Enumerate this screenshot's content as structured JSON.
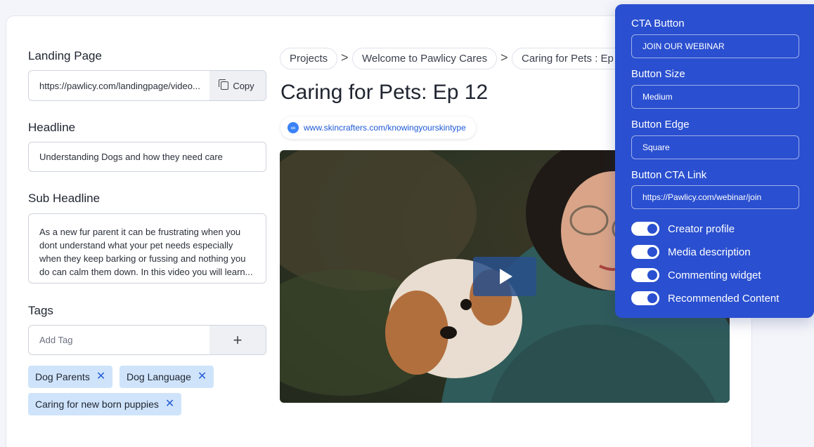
{
  "left": {
    "landing_label": "Landing Page",
    "landing_url": "https://pawlicy.com/landingpage/video...",
    "copy_label": "Copy",
    "headline_label": "Headline",
    "headline_value": "Understanding Dogs and how they need care",
    "sub_label": "Sub Headline",
    "sub_value": "As a new fur parent it can be frustrating when you dont understand what your pet needs especially when they keep barking or fussing and nothing you do can calm them down. In this video you will learn...",
    "tags_label": "Tags",
    "tag_placeholder": "Add Tag",
    "add_glyph": "+",
    "tags": [
      "Dog Parents",
      "Dog Language",
      "Caring for new born puppies"
    ],
    "remove_glyph": "✕"
  },
  "breadcrumb": [
    "Projects",
    "Welcome to Pawlicy Cares",
    "Caring for Pets : Ep"
  ],
  "breadcrumb_sep": ">",
  "title": "Caring for Pets: Ep 12",
  "link": "www.skincrafters.com/knowingyourskintype",
  "panel": {
    "cta_label": "CTA Button",
    "cta_value": "JOIN OUR WEBINAR",
    "size_label": "Button Size",
    "size_value": "Medium",
    "edge_label": "Button Edge",
    "edge_value": "Square",
    "link_label": "Button CTA Link",
    "link_value": "https://Pawlicy.com/webinar/join",
    "toggles": [
      "Creator profile",
      "Media description",
      "Commenting widget",
      "Recommended Content"
    ]
  },
  "colors": {
    "accent": "#2a4fd0",
    "chip": "#cfe4fb",
    "link": "#1e5ad6"
  }
}
